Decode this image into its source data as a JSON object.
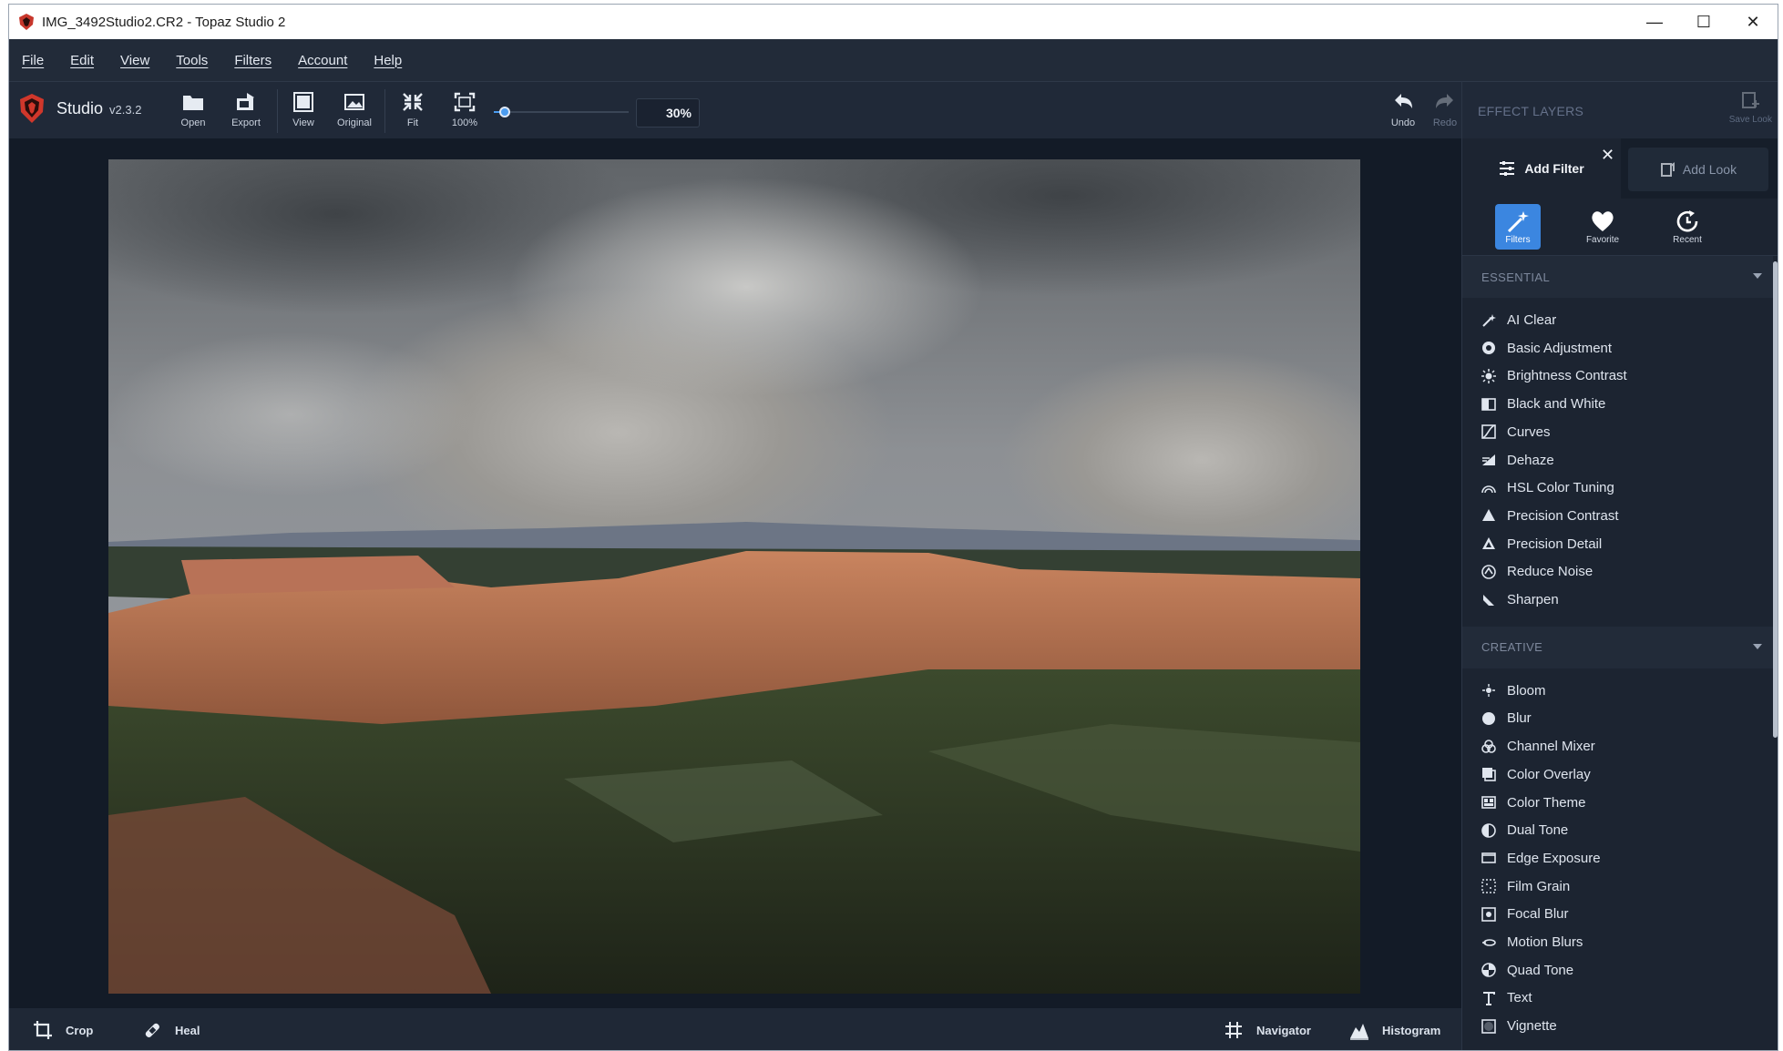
{
  "window": {
    "title": "IMG_3492Studio2.CR2 - Topaz Studio 2",
    "controls": [
      "—",
      "☐",
      "✕"
    ]
  },
  "menu": [
    "File",
    "Edit",
    "View",
    "Tools",
    "Filters",
    "Account",
    "Help"
  ],
  "brand": {
    "name": "Studio",
    "version": "v2.3.2"
  },
  "toolbar": {
    "open": "Open",
    "export": "Export",
    "view": "View",
    "original": "Original",
    "fit": "Fit",
    "hundred": "100%",
    "zoom_value": "30%",
    "zoom_fraction": 0.08,
    "undo": "Undo",
    "redo": "Redo"
  },
  "panel": {
    "title": "EFFECT LAYERS",
    "save_look": "Save Look",
    "add_filter": "Add Filter",
    "add_look": "Add Look",
    "tabs": [
      "Filters",
      "Favorite",
      "Recent"
    ],
    "active_tab": "Filters",
    "sections": [
      {
        "name": "ESSENTIAL",
        "items": [
          {
            "label": "AI Clear",
            "icon": "wand-icon"
          },
          {
            "label": "Basic Adjustment",
            "icon": "aperture-icon"
          },
          {
            "label": "Brightness Contrast",
            "icon": "sun-icon"
          },
          {
            "label": "Black and White",
            "icon": "half-square-icon"
          },
          {
            "label": "Curves",
            "icon": "curve-icon"
          },
          {
            "label": "Dehaze",
            "icon": "haze-icon"
          },
          {
            "label": "HSL Color Tuning",
            "icon": "rainbow-icon"
          },
          {
            "label": "Precision Contrast",
            "icon": "triangle-icon"
          },
          {
            "label": "Precision Detail",
            "icon": "triangle-detail-icon"
          },
          {
            "label": "Reduce Noise",
            "icon": "noise-icon"
          },
          {
            "label": "Sharpen",
            "icon": "sharpen-icon"
          }
        ]
      },
      {
        "name": "CREATIVE",
        "items": [
          {
            "label": "Bloom",
            "icon": "bloom-icon"
          },
          {
            "label": "Blur",
            "icon": "circle-icon"
          },
          {
            "label": "Channel Mixer",
            "icon": "channels-icon"
          },
          {
            "label": "Color Overlay",
            "icon": "overlay-icon"
          },
          {
            "label": "Color Theme",
            "icon": "palette-icon"
          },
          {
            "label": "Dual Tone",
            "icon": "dual-tone-icon"
          },
          {
            "label": "Edge Exposure",
            "icon": "edge-icon"
          },
          {
            "label": "Film Grain",
            "icon": "grain-icon"
          },
          {
            "label": "Focal Blur",
            "icon": "focal-icon"
          },
          {
            "label": "Motion Blurs",
            "icon": "motion-icon"
          },
          {
            "label": "Quad Tone",
            "icon": "quad-icon"
          },
          {
            "label": "Text",
            "icon": "text-icon"
          },
          {
            "label": "Vignette",
            "icon": "vignette-icon"
          }
        ]
      }
    ]
  },
  "bottom": {
    "crop": "Crop",
    "heal": "Heal",
    "navigator": "Navigator",
    "histogram": "Histogram"
  },
  "colors": {
    "accent": "#3b86e0",
    "brand_red": "#d0372b"
  }
}
